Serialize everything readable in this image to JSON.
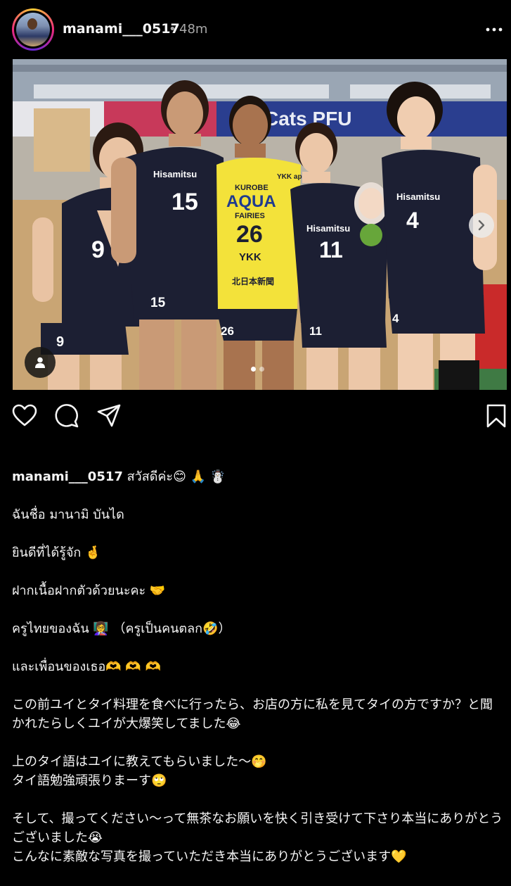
{
  "post": {
    "username": "manami___0517",
    "separator": "•",
    "time": "48m"
  },
  "photo": {
    "carousel_dots": 2,
    "active_dot": 0
  },
  "players": {
    "p1_jersey": "9",
    "p2_jersey": "15",
    "p3_jersey": "26",
    "p4_jersey": "11",
    "p5_jersey": "4",
    "p3_team_line1": "KUROBE",
    "p3_team_line2": "AQUA",
    "p3_team_line3": "FAIRIES",
    "p3_sponsor": "YKK",
    "p3_sponsor_badge": "YKK ap",
    "p3_sponsor_line2": "北日本新聞",
    "team_sponsor": "Hisamitsu",
    "banner_text": "U  Cats  PFU"
  },
  "caption": {
    "user": "manami___0517",
    "line1": "สวัสดีค่ะ😊 🙏 ☃️",
    "line2": "ฉันชื่อ มานามิ บันได",
    "line3": "ยินดีที่ได้รู้จัก 🤞",
    "line4": "ฝากเนื้อฝากตัวด้วยนะคะ 🤝",
    "line5": "ครูไทยของฉัน 👩‍🏫  （ครูเป็นคนตลก🤣）",
    "line6": "และเพื่อนของเธอ🫶 🫶 🫶",
    "line7": "この前ユイとタイ料理を食べに行ったら、お店の方に私を見てタイの方ですか？と聞かれたらしくユイが大爆笑してました😂",
    "line8a": "上のタイ語はユイに教えてもらいました〜🤭",
    "line8b": "タイ語勉強頑張りまーす🙄",
    "line9": "そして、撮ってください〜って無茶なお願いを快く引き受けて下さり本当にありがとうございました😭",
    "line10": "こんなに素敵な写真を撮っていただき本当にありがとうございます💛"
  },
  "colors": {
    "background": "#000000",
    "text": "#f5f5f5",
    "muted": "#a8a8a8",
    "jersey_dark": "#1c1f33",
    "jersey_yellow": "#f3e23a",
    "court": "#c9a574"
  },
  "icons": {
    "more": "more-horizontal-icon",
    "like": "heart-icon",
    "comment": "comment-bubble-icon",
    "share": "paper-plane-icon",
    "save": "bookmark-icon",
    "next": "chevron-right-icon",
    "tag": "user-tag-icon"
  }
}
